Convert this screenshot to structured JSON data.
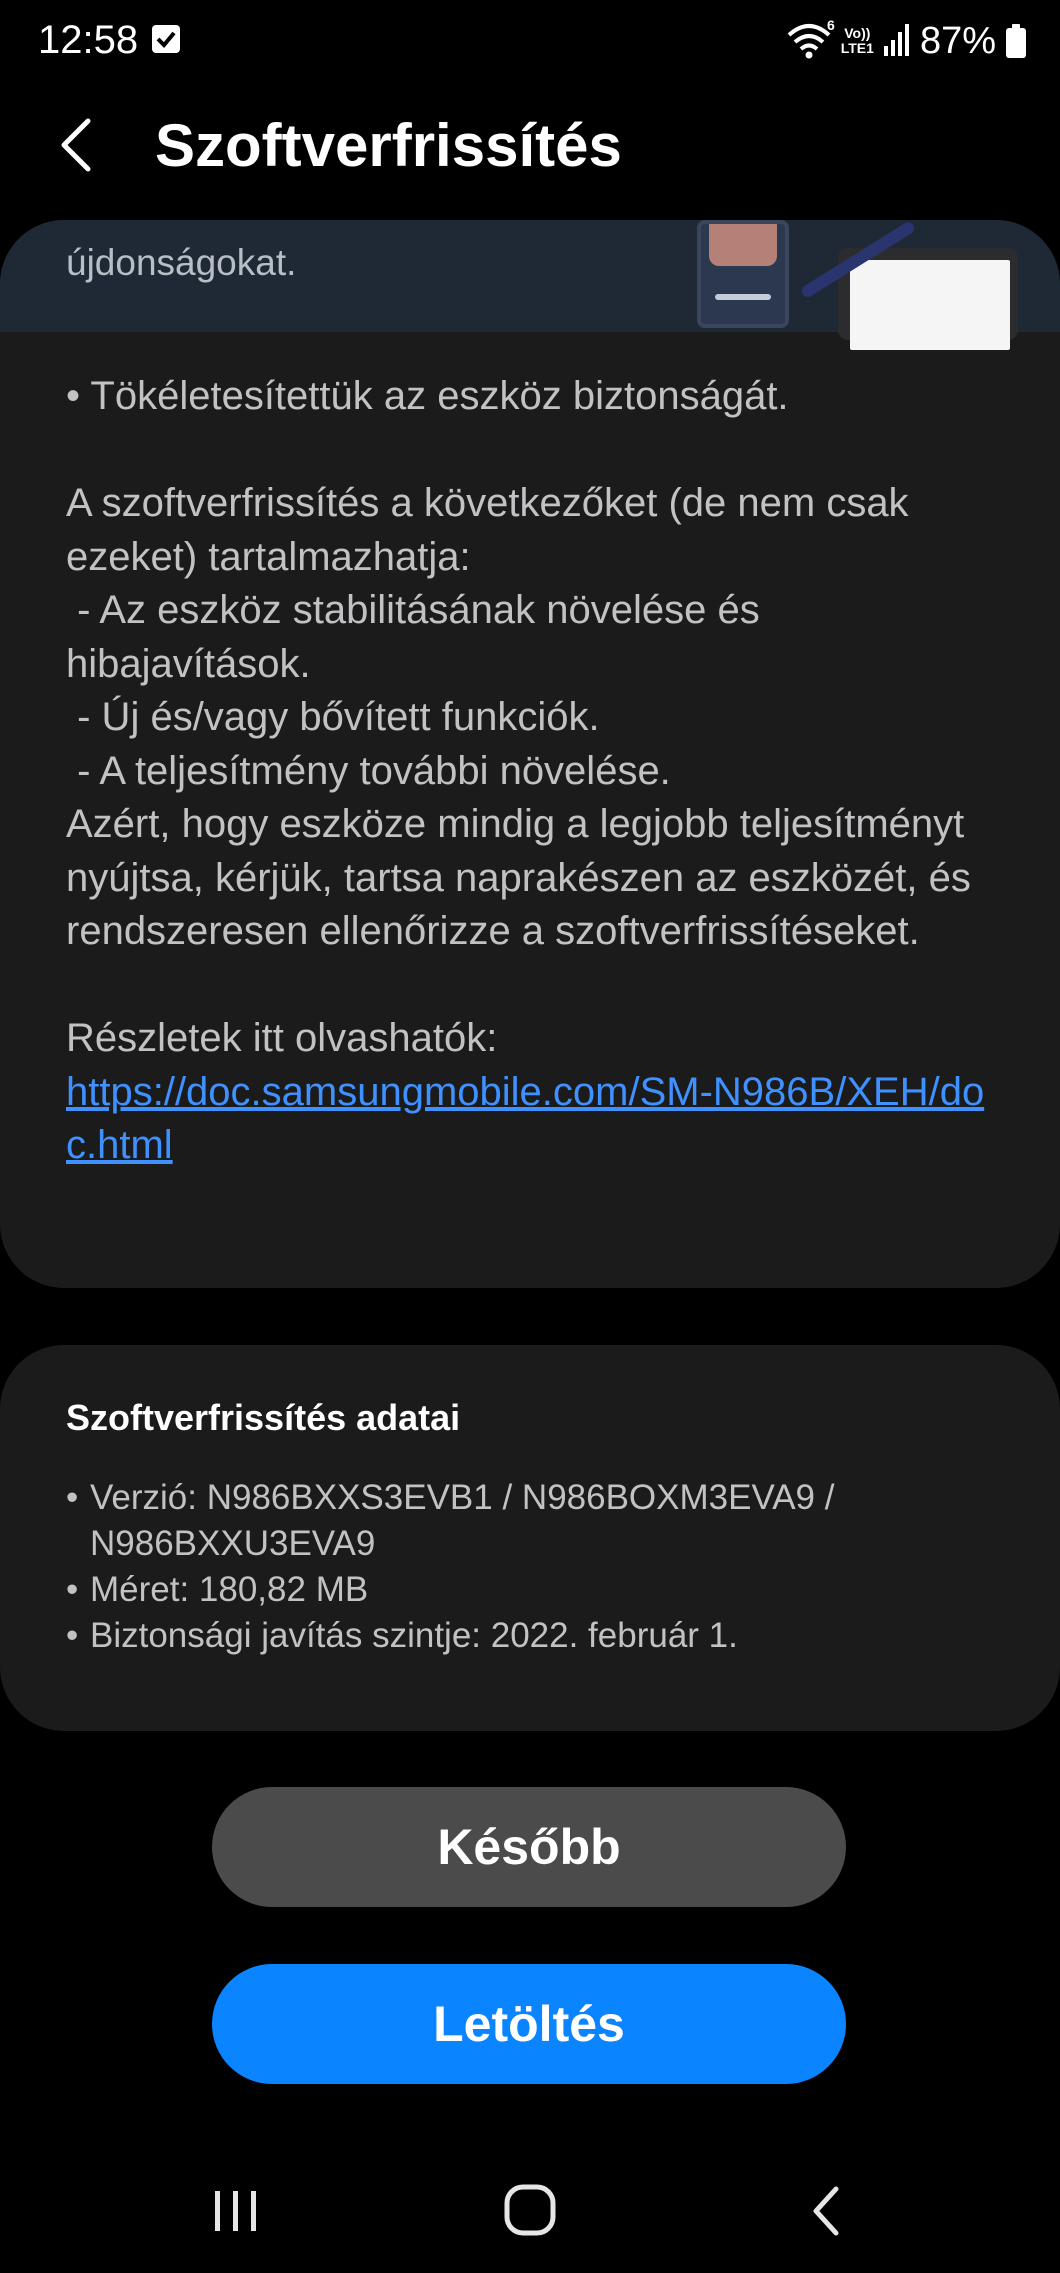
{
  "status_bar": {
    "time": "12:58",
    "network_top": "Vo))",
    "network_bottom": "LTE1",
    "wifi_badge": "6",
    "battery": "87%",
    "icons": [
      "checkbox-notification-icon",
      "wifi-icon",
      "volte-icon",
      "signal-icon",
      "battery-icon"
    ]
  },
  "header": {
    "title": "Szoftverfrissítés",
    "back_icon": "chevron-left-icon"
  },
  "notes_card": {
    "banner_text": "újdonságokat.",
    "paragraphs": [
      "• Tökéletesítettük az eszköz biztonságát.",
      "A szoftverfrissítés a következőket (de nem csak ezeket) tartalmazhatja:\n - Az eszköz stabilitásának növelése és hibajavítások.\n - Új és/vagy bővített funkciók.\n - A teljesítmény további növelése.\nAzért, hogy eszköze mindig a legjobb teljesítményt nyújtsa, kérjük, tartsa naprakészen az eszközét, és rendszeresen ellenőrizze a szoftverfrissítéseket.",
      "Részletek itt olvashatók:"
    ],
    "link": "https://doc.samsungmobile.com/SM-N986B/XEH/doc.html"
  },
  "info_card": {
    "title": "Szoftverfrissítés adatai",
    "items": [
      "Verzió: N986BXXS3EVB1 / N986BOXM3EVA9 / N986BXXU3EVA9",
      "Méret: 180,82 MB",
      "Biztonsági javítás szintje: 2022. február 1."
    ]
  },
  "buttons": {
    "later": "Később",
    "download": "Letöltés"
  },
  "nav_bar": {
    "icons": [
      "recent-apps-icon",
      "home-icon",
      "back-icon"
    ]
  },
  "colors": {
    "background": "#000000",
    "card": "#1b1b1c",
    "link": "#3e91ff",
    "primary_button": "#0a84ff",
    "secondary_button": "#4b4b4b"
  }
}
